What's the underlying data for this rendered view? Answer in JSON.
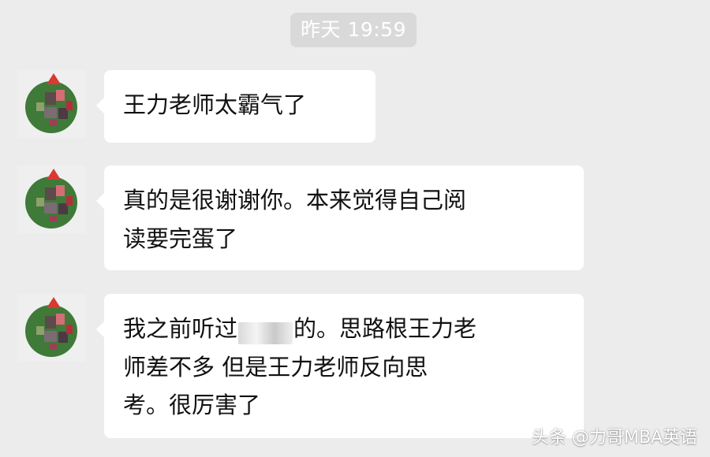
{
  "timestamp": "昨天 19:59",
  "messages": [
    {
      "text": "王力老师太霸气了"
    },
    {
      "text": "真的是很谢谢你。本来觉得自己阅\n读要完蛋了"
    },
    {
      "text_before": "我之前听过",
      "text_after": "的。思路根王力老\n师差不多 但是王力老师反向思\n考。很厉害了"
    }
  ],
  "watermark": "头条 @力哥MBA英语"
}
